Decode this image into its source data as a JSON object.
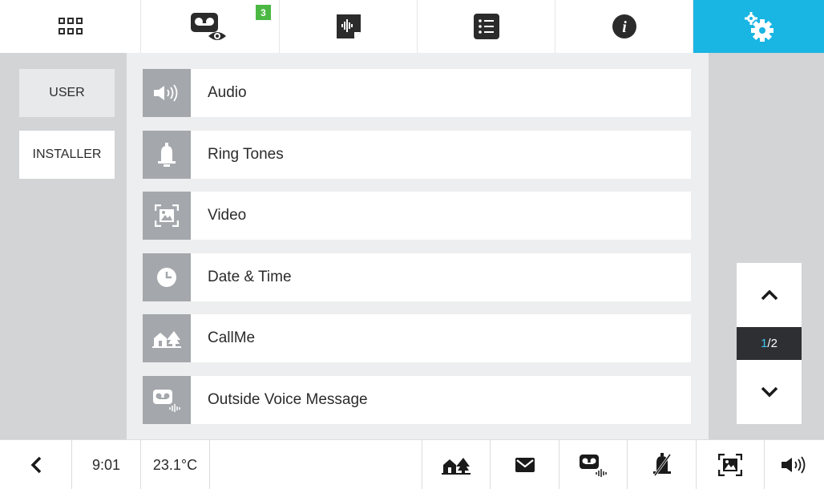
{
  "topbar": {
    "tabs": [
      {
        "icon": "apps-grid-icon"
      },
      {
        "icon": "voice-message-view-icon",
        "badge": "3"
      },
      {
        "icon": "audio-memo-icon"
      },
      {
        "icon": "list-icon"
      },
      {
        "icon": "info-icon"
      },
      {
        "icon": "settings-gears-icon",
        "active": true
      }
    ],
    "accent": "#19b5e3",
    "badge_color": "#4bb843"
  },
  "sidebar": {
    "user_label": "USER",
    "installer_label": "INSTALLER"
  },
  "menu": {
    "items": [
      {
        "label": "Audio",
        "icon": "speaker-icon"
      },
      {
        "label": "Ring Tones",
        "icon": "bell-icon"
      },
      {
        "label": "Video",
        "icon": "video-frame-icon"
      },
      {
        "label": "Date & Time",
        "icon": "clock-icon"
      },
      {
        "label": "CallMe",
        "icon": "callme-house-icon"
      },
      {
        "label": "Outside Voice Message",
        "icon": "voice-message-icon"
      }
    ]
  },
  "pager": {
    "current": "1",
    "total": "/2"
  },
  "bottombar": {
    "time": "9:01",
    "temperature": "23.1°C",
    "icons": [
      "back-icon",
      "callme-house-icon",
      "mail-icon",
      "voice-message-icon",
      "bell-muted-icon",
      "video-frame-icon",
      "speaker-icon"
    ]
  }
}
